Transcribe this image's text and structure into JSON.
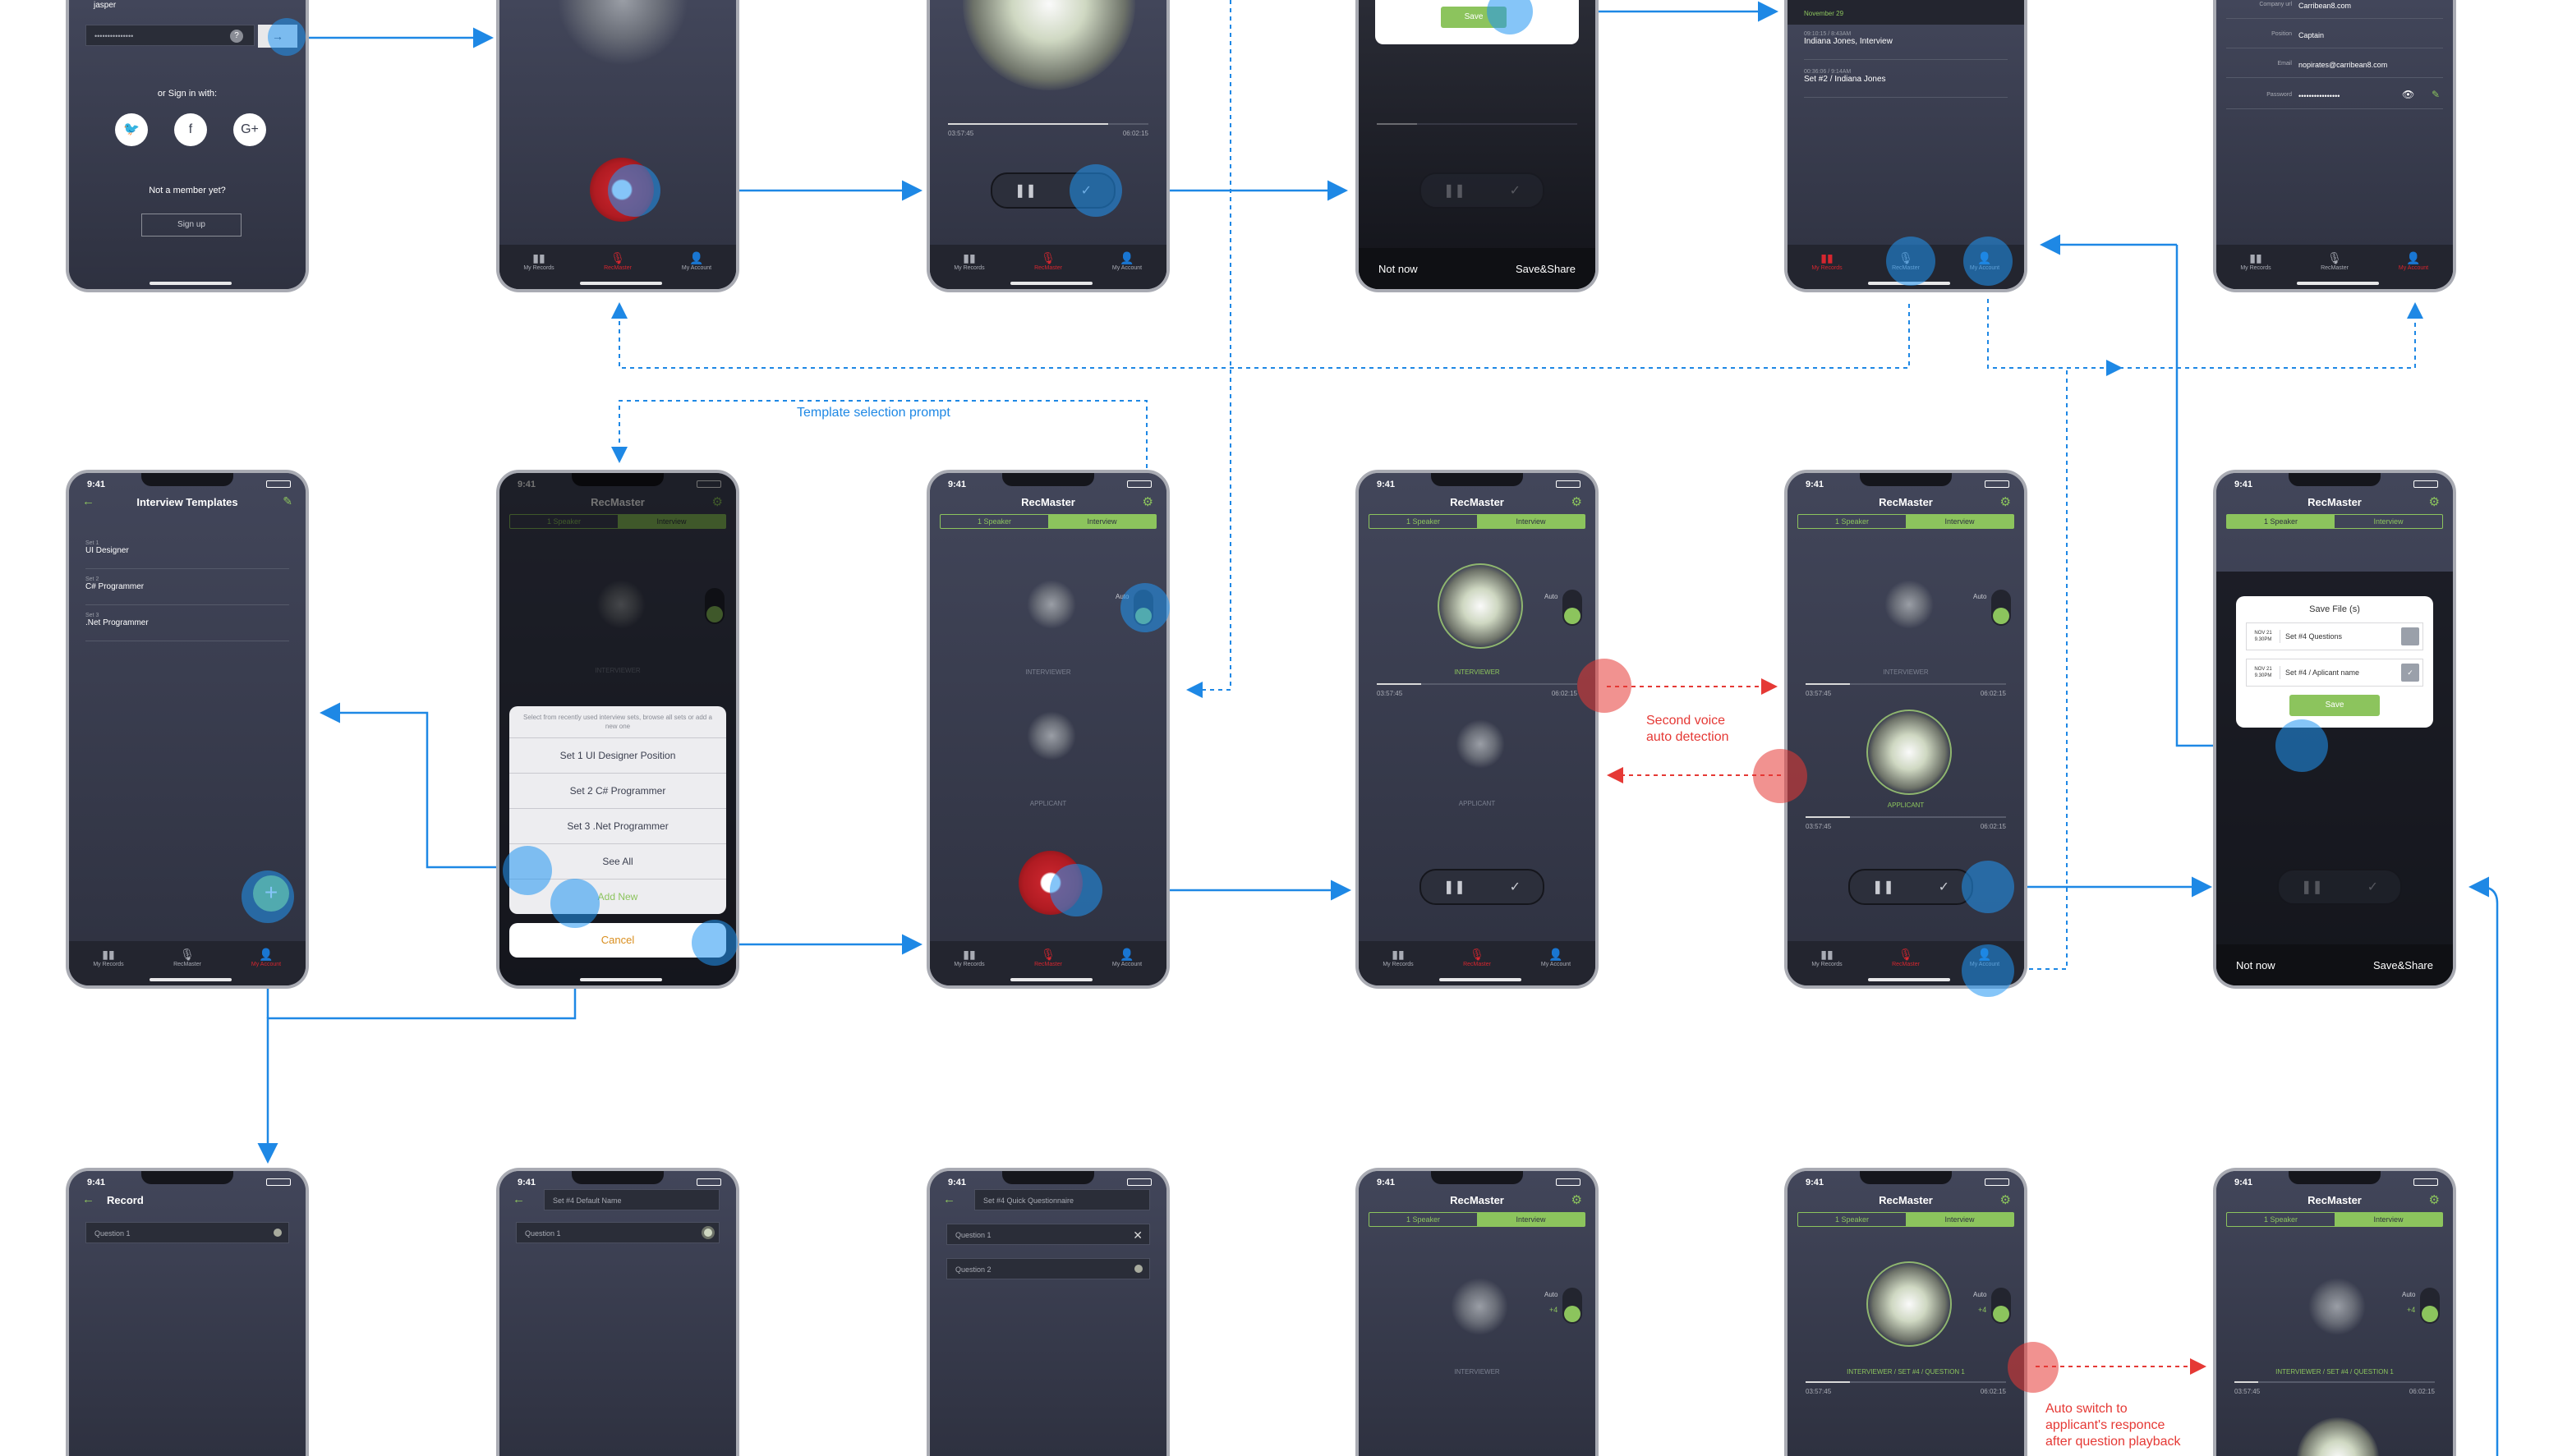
{
  "common": {
    "time": "9:41",
    "app_title": "RecMaster",
    "tabs": [
      "My Records",
      "RecMaster",
      "My Account"
    ],
    "seg_speaker": "1 Speaker",
    "seg_interview": "Interview",
    "auto": "Auto",
    "plus4": "+4",
    "interviewer": "INTERVIEWER",
    "applicant": "APPLICANT",
    "elapsed": "03:57:45",
    "total": "06:02:15",
    "not_now": "Not now",
    "save_share": "Save&Share",
    "save": "Save"
  },
  "login": {
    "user": "jasper",
    "password": "•••••••••••••••",
    "or_sign_in": "or Sign in with:",
    "not_member": "Not a member yet?",
    "sign_up": "Sign up"
  },
  "records": {
    "date": "November 29",
    "items": [
      {
        "time": "09:10:15 / 8:43AM",
        "title": "Indiana Jones, Interview"
      },
      {
        "time": "00:36:06 / 9:14AM",
        "title": "Set #2 / Indiana Jones"
      }
    ]
  },
  "account": {
    "rows": [
      {
        "key": "Company url",
        "val": "Carribean8.com"
      },
      {
        "key": "Position",
        "val": "Captain"
      },
      {
        "key": "Email",
        "val": "nopirates@carribean8.com"
      },
      {
        "key": "Password",
        "val": "••••••••••••••••"
      }
    ]
  },
  "templates": {
    "title": "Interview Templates",
    "items": [
      {
        "set": "Set 1",
        "name": "UI Designer"
      },
      {
        "set": "Set 2",
        "name": "C# Programmer"
      },
      {
        "set": "Set 3",
        "name": ".Net Programmer"
      }
    ]
  },
  "prompt": {
    "note": "Select from recently used interview sets, browse all sets or add a new one",
    "items": [
      "Set 1 UI Designer Position",
      "Set 2 C# Programmer",
      "Set 3 .Net Programmer",
      "See All",
      "Add New"
    ],
    "cancel": "Cancel"
  },
  "save_files": {
    "title": "Save File (s)",
    "rows": [
      {
        "date": "NOV 21 9.30PM",
        "name": "Set #4 Questions"
      },
      {
        "date": "NOV 21 9.30PM",
        "name": "Set #4 / Aplicant  name"
      }
    ]
  },
  "record_screen": {
    "title": "Record",
    "q1": "Question 1",
    "default_name": "Set #4 Default Name",
    "quick_name": "Set #4 Quick Questionnaire",
    "q2": "Question 2"
  },
  "row3": {
    "label5": "INTERVIEWER / SET #4 / QUESTION 1",
    "label6": "INTERVIEWER / SET #4 / QUESTION 1"
  },
  "captions": {
    "template_prompt": "Template selection prompt",
    "second_voice": "Second voice\nauto detection",
    "auto_switch": "Auto switch to\napplicant's responce\nafter question playback"
  },
  "colors": {
    "flow_blue": "#1e88e5",
    "flow_red": "#e53935",
    "accent_green": "#8cc45d",
    "record_red": "#c4232b"
  }
}
